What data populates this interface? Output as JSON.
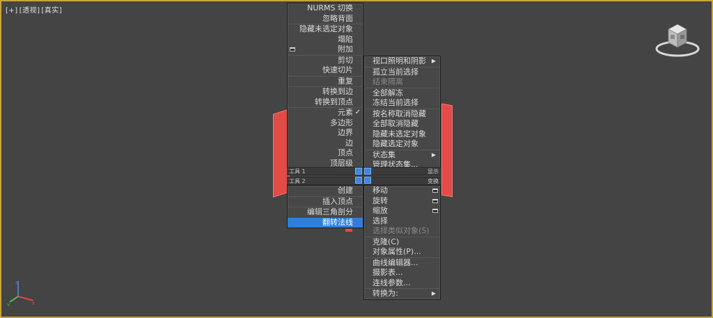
{
  "viewport": {
    "label_plus": "[+]",
    "label_view": "[透视]",
    "label_shade": "[真实]"
  },
  "colors": {
    "accent": "#2f7fd8",
    "viewport_border": "#c9a63a",
    "object": "#e24b46",
    "menu_bg": "#474747"
  },
  "top_left_menu": {
    "items": [
      {
        "label": "NURMS 切换",
        "disabled": false
      },
      {
        "label": "忽略背面",
        "disabled": false
      },
      {
        "label": "隐藏未选定对象",
        "disabled": false
      },
      {
        "label": "塌陷",
        "disabled": false
      },
      {
        "label": "附加",
        "disabled": false
      },
      {
        "label": "剪切",
        "disabled": false
      },
      {
        "label": "快速切片",
        "disabled": false
      },
      {
        "label": "重复",
        "disabled": false
      },
      {
        "label": "转换到边",
        "disabled": false
      },
      {
        "label": "转换到顶点",
        "disabled": false
      },
      {
        "label": "元素",
        "disabled": false,
        "checked": true
      },
      {
        "label": "多边形",
        "disabled": false
      },
      {
        "label": "边界",
        "disabled": false
      },
      {
        "label": "边",
        "disabled": false
      },
      {
        "label": "顶点",
        "disabled": false
      },
      {
        "label": "顶层级",
        "disabled": false
      }
    ]
  },
  "top_right_menu": {
    "items": [
      {
        "label": "视口照明和阴影",
        "submenu": true
      },
      {
        "label": "孤立当前选择",
        "disabled": false
      },
      {
        "label": "结束隔离",
        "disabled": true
      },
      {
        "label": "全部解冻",
        "disabled": false
      },
      {
        "label": "冻结当前选择",
        "disabled": false
      },
      {
        "label": "按名称取消隐藏",
        "disabled": false
      },
      {
        "label": "全部取消隐藏",
        "disabled": false
      },
      {
        "label": "隐藏未选定对象",
        "disabled": false
      },
      {
        "label": "隐藏选定对象",
        "disabled": false
      },
      {
        "label": "状态集",
        "submenu": true
      },
      {
        "label": "管理状态集...",
        "disabled": false
      }
    ]
  },
  "quad_titles": {
    "tools1": "工具 1",
    "tools2": "工具 2",
    "display": "显示",
    "transform": "变换"
  },
  "bottom_left_menu": {
    "items": [
      {
        "label": "创建",
        "disabled": false
      },
      {
        "label": "插入顶点",
        "disabled": false
      },
      {
        "label": "编辑三角剖分",
        "disabled": false
      },
      {
        "label": "翻转法线",
        "disabled": false,
        "highlighted": true
      }
    ]
  },
  "bottom_right_menu": {
    "items": [
      {
        "label": "移动",
        "disabled": false
      },
      {
        "label": "旋转",
        "disabled": false
      },
      {
        "label": "缩放",
        "disabled": false
      },
      {
        "label": "选择",
        "disabled": false
      },
      {
        "label": "选择类似对象(S)",
        "disabled": true
      },
      {
        "label": "克隆(C)",
        "disabled": false
      },
      {
        "label": "对象属性(P)...",
        "disabled": false
      },
      {
        "label": "曲线编辑器...",
        "disabled": false
      },
      {
        "label": "摄影表...",
        "disabled": false
      },
      {
        "label": "连线参数...",
        "disabled": false
      },
      {
        "label": "转换为:",
        "disabled": false,
        "submenu": true
      }
    ]
  },
  "icons": {
    "check": "checkmark-icon",
    "submenu": "triangle-right-icon",
    "options": "options-box-icon",
    "viewcube": "viewcube-icon",
    "axis": "axis-tripod-icon"
  }
}
